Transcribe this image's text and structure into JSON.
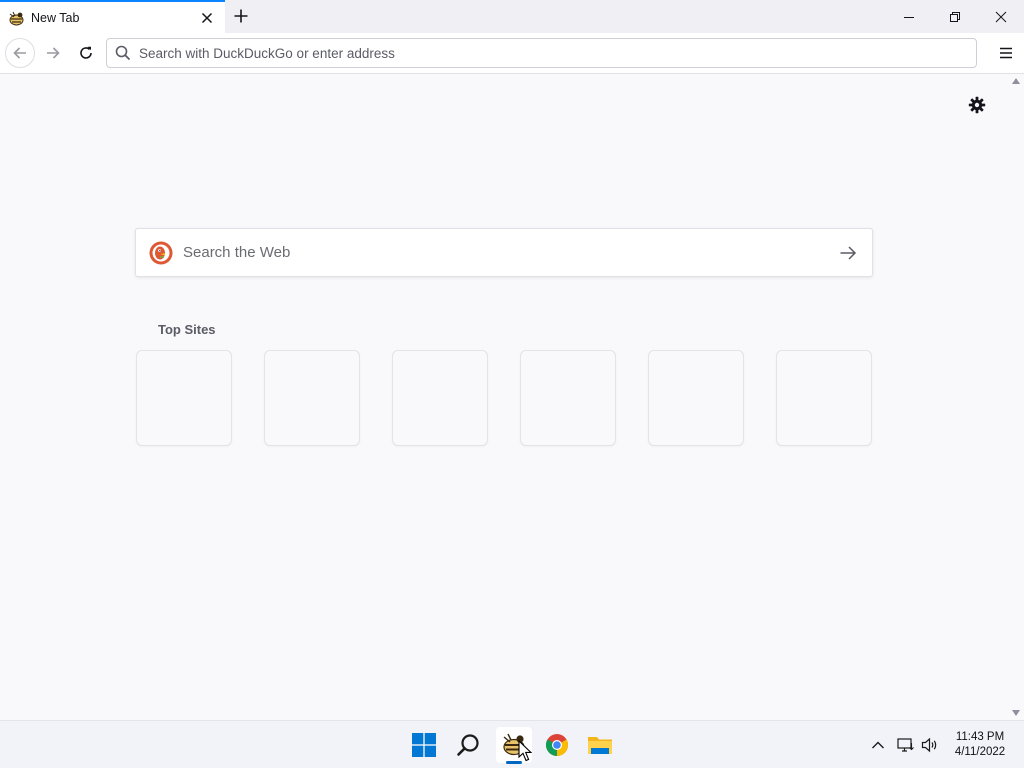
{
  "browser": {
    "tab": {
      "title": "New Tab"
    },
    "urlbar": {
      "placeholder": "Search with DuckDuckGo or enter address"
    },
    "accent_color": "#0a84ff"
  },
  "newtab": {
    "search": {
      "placeholder": "Search the Web",
      "engine_icon": "duckduckgo-logo"
    },
    "top_sites": {
      "title": "Top Sites",
      "tiles": [
        {},
        {},
        {},
        {},
        {},
        {}
      ]
    },
    "settings_icon": "gear-icon"
  },
  "taskbar": {
    "apps": [
      "start-icon",
      "search-icon",
      "firefox-nightly-icon",
      "chrome-icon",
      "file-explorer-icon"
    ],
    "active_app": "firefox-nightly-icon",
    "tray": [
      "chevron-up-icon",
      "network-icon",
      "volume-icon"
    ],
    "clock": {
      "time": "11:43 PM",
      "date": "4/11/2022"
    }
  }
}
